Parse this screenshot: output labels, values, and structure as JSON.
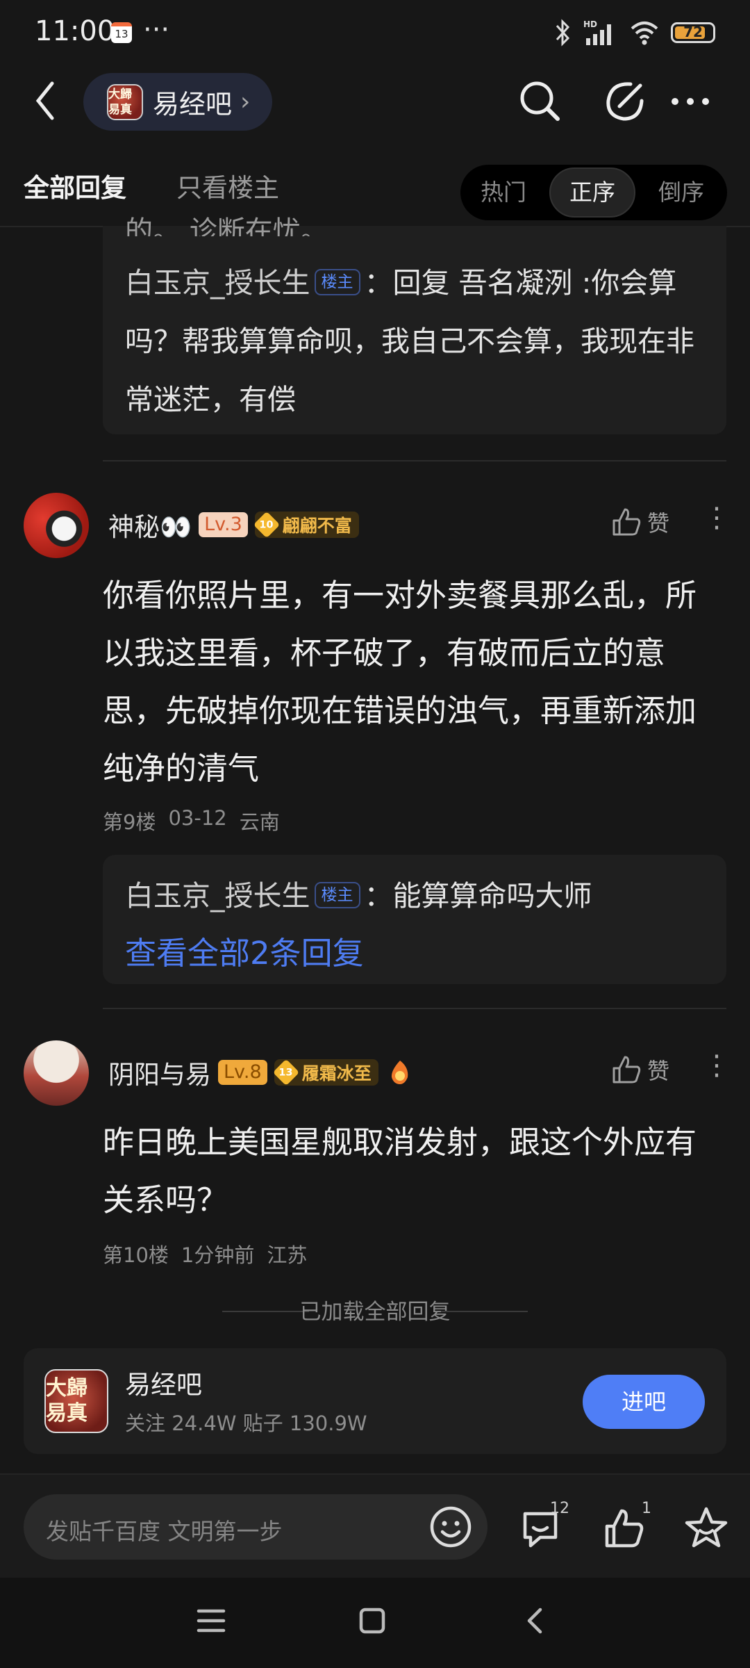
{
  "status_bar": {
    "time": "11:00",
    "calendar_day": "13",
    "more": "···",
    "battery": "72"
  },
  "header": {
    "forum_name": "易经吧",
    "forum_avatar_text": "大歸易真"
  },
  "tabs": {
    "all": "全部回复",
    "owner_only": "只看楼主"
  },
  "sort": {
    "hot": "热门",
    "asc": "正序",
    "desc": "倒序"
  },
  "top_reply_box": {
    "cut_text": "的。  诊断在忧。",
    "author": "白玉京_授长生",
    "badge": "楼主",
    "text": "：回复 吾名凝洌 :你会算吗？帮我算算命呗，我自己不会算，我现在非常迷茫，有偿"
  },
  "posts": [
    {
      "user": "神秘👀",
      "level": "Lv.3",
      "medal_num": "10",
      "medal_title": "翩翩不富",
      "like_label": "赞",
      "content": "你看你照片里，有一对外卖餐具那么乱，所以我这里看，杯子破了，有破而后立的意思，先破掉你现在错误的浊气，再重新添加纯净的清气",
      "floor": "第9楼",
      "date": "03-12",
      "location": "云南",
      "reply": {
        "author": "白玉京_授长生",
        "badge": "楼主",
        "text": "：能算算命吗大师",
        "view_all": "查看全部2条回复"
      }
    },
    {
      "user": "阴阳与易",
      "level": "Lv.8",
      "medal_num": "13",
      "medal_title": "履霜冰至",
      "like_label": "赞",
      "content": "昨日晚上美国星舰取消发射，跟这个外应有关系吗？",
      "floor": "第10楼",
      "date": "1分钟前",
      "location": "江苏"
    }
  ],
  "all_loaded": "已加载全部回复",
  "forum_card": {
    "name": "易经吧",
    "avatar_text": "大歸易真",
    "stats": "关注 24.4W   贴子 130.9W",
    "join": "进吧"
  },
  "bottom_bar": {
    "placeholder": "发贴千百度 文明第一步",
    "comment_count": "12",
    "like_count": "1"
  }
}
